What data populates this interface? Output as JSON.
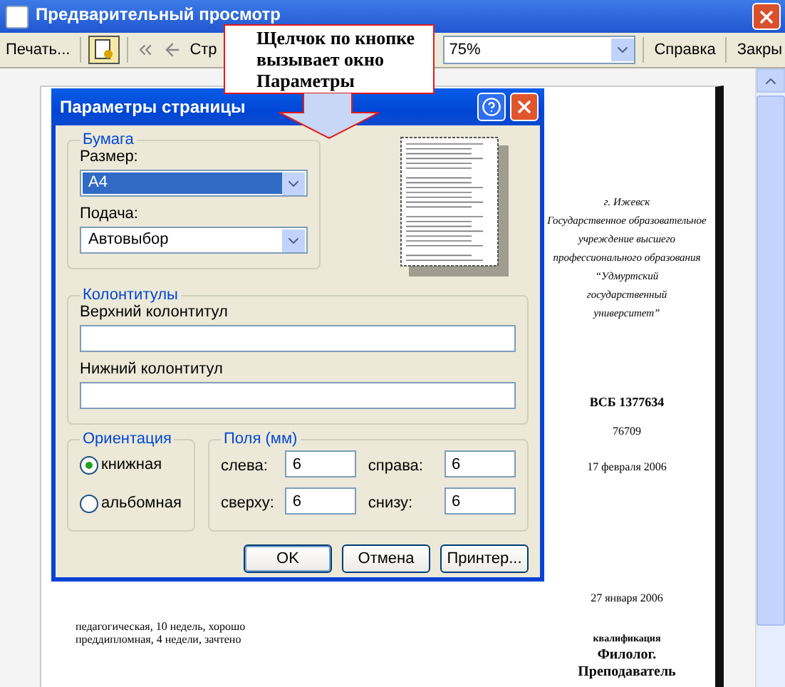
{
  "window": {
    "title": "Предварительный просмотр"
  },
  "toolbar": {
    "print": "Печать...",
    "page_label": "Стр",
    "zoom": "75%",
    "help": "Справка",
    "close": "Закры"
  },
  "callout": {
    "text": "Щелчок по кнопке вызывает окно Параметры"
  },
  "document": {
    "header_lines": [
      "г. Ижевск",
      "Государственное образовательное",
      "учреждение высшего",
      "профессионального образования",
      "“Удмуртский",
      "государственный",
      "университет”"
    ],
    "code": "ВСБ 1377634",
    "number": "76709",
    "date1": "17 февраля 2006",
    "date2": "27 января 2006",
    "practice_lines": [
      "педагогическая, 10 недель, хорошо",
      "преддипломная, 4 недели, зачтено"
    ],
    "qualification_label": "квалификация",
    "qualification": [
      "Филолог.",
      "Преподаватель"
    ]
  },
  "dialog": {
    "title": "Параметры страницы",
    "paper": {
      "legend": "Бумага",
      "size_label": "Размер:",
      "size": "A4",
      "source_label": "Подача:",
      "source": "Автовыбор"
    },
    "headers": {
      "legend": "Колонтитулы",
      "header_label": "Верхний колонтитул",
      "footer_label": "Нижний колонтитул"
    },
    "orientation": {
      "legend": "Ориентация",
      "options": [
        {
          "label": "книжная",
          "selected": true
        },
        {
          "label": "альбомная",
          "selected": false
        }
      ]
    },
    "margins": {
      "legend": "Поля (мм)",
      "fields": [
        {
          "label": "слева:",
          "value": "6"
        },
        {
          "label": "справа:",
          "value": "6"
        },
        {
          "label": "сверху:",
          "value": "6"
        },
        {
          "label": "снизу:",
          "value": "6"
        }
      ]
    },
    "buttons": [
      "OK",
      "Отмена",
      "Принтер..."
    ]
  }
}
